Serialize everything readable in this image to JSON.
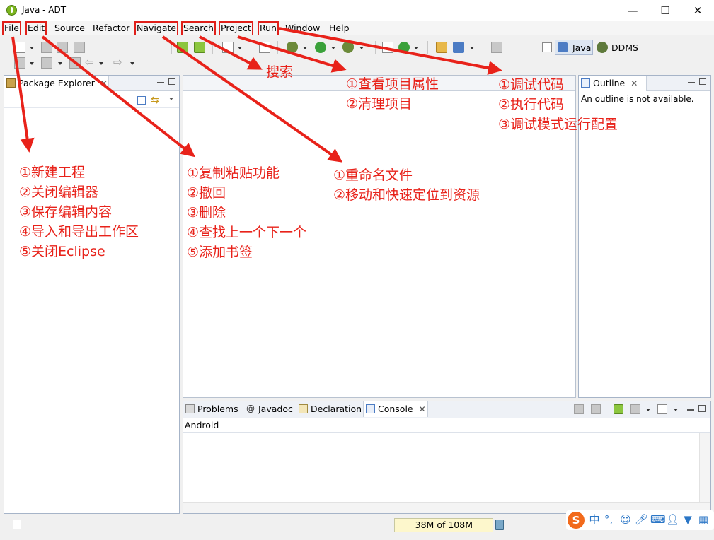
{
  "window": {
    "title": "Java - ADT"
  },
  "menu": [
    "File",
    "Edit",
    "Source",
    "Refactor",
    "Navigate",
    "Search",
    "Project",
    "Run",
    "Window",
    "Help"
  ],
  "perspectives": {
    "java": "Java",
    "ddms": "DDMS"
  },
  "package_explorer": {
    "title": "Package Explorer"
  },
  "outline": {
    "title": "Outline",
    "message": "An outline is not available."
  },
  "bottom_tabs": [
    "Problems",
    "Javadoc",
    "Declaration",
    "Console"
  ],
  "console": {
    "label": "Android"
  },
  "status": {
    "heap": "38M of 108M"
  },
  "ime": {
    "lang": "中",
    "punct": "°,"
  },
  "annotations": {
    "file": [
      "①新建工程",
      "②关闭编辑器",
      "③保存编辑内容",
      "④导入和导出工作区",
      "⑤关闭Eclipse"
    ],
    "edit": [
      "①复制粘贴功能",
      "②撤回",
      "③删除",
      "④查找上一个下一个",
      "⑤添加书签"
    ],
    "navigate": [
      "①重命名文件",
      "②移动和快速定位到资源"
    ],
    "search": "搜索",
    "project": [
      "①查看项目属性",
      "②清理项目"
    ],
    "run": [
      "①调试代码",
      "②执行代码",
      "③调试模式运行配置"
    ]
  },
  "colors": {
    "annotation": "#e8221a",
    "panel_border": "#a6b4c8"
  }
}
